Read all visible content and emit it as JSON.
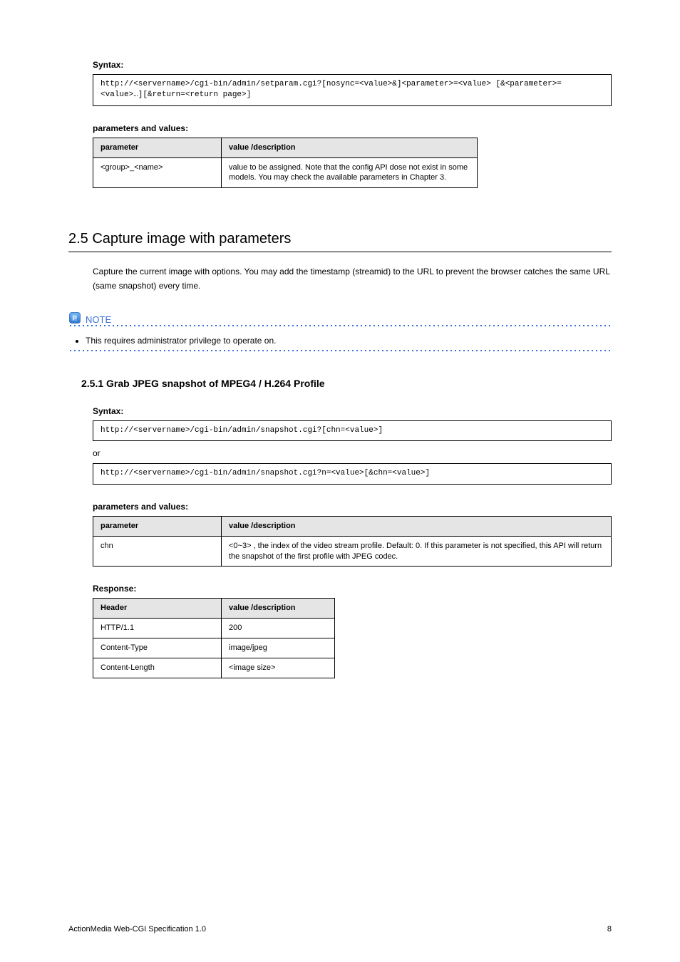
{
  "section1": {
    "syntax_label": "Syntax:",
    "code": "http://<servername>/cgi-bin/admin/setparam.cgi?[nosync=<value>&]<parameter>=<value>\n[&<parameter>=<value>…][&return=<return page>]",
    "param_label": "parameters and values:",
    "table": {
      "headers": [
        "parameter",
        "value /description"
      ],
      "rows": [
        [
          "<group>_<name>",
          "value to be assigned. Note that the config API dose not exist in some models. You may check the available parameters in Chapter 3."
        ]
      ]
    }
  },
  "section2": {
    "heading": "2.5 Capture image with parameters",
    "body": "Capture the current image with options. You may add the timestamp (streamid) to the URL to prevent the browser catches the same URL (same snapshot) every time.",
    "note": {
      "label": "NOTE",
      "items": [
        "This requires administrator privilege to operate on."
      ]
    },
    "subheading": "2.5.1 Grab JPEG snapshot of MPEG4 / H.264 Profile",
    "syntax_label": "Syntax:",
    "code1": "http://<servername>/cgi-bin/admin/snapshot.cgi?[chn=<value>]",
    "or_label": "or",
    "code2": "http://<servername>/cgi-bin/admin/snapshot.cgi?n=<value>[&chn=<value>]",
    "param_label": "parameters and values:",
    "table1": {
      "headers": [
        "parameter",
        "value /description"
      ],
      "col_a_width": 180,
      "rows": [
        [
          "chn",
          "<0~3> , the index of the video stream profile. Default: 0. If this parameter is not specified, this API will return the snapshot of the first profile with JPEG codec."
        ]
      ]
    },
    "response_label": "Response:",
    "table2": {
      "headers": [
        "Header",
        "value /description"
      ],
      "col_a_width": 180,
      "rows": [
        [
          "HTTP/1.1",
          "200"
        ],
        [
          "Content-Type",
          "image/jpeg"
        ],
        [
          "Content-Length",
          "<image size>"
        ]
      ]
    }
  },
  "footer": {
    "left": "ActionMedia Web-CGI Specification 1.0",
    "right": "8"
  }
}
